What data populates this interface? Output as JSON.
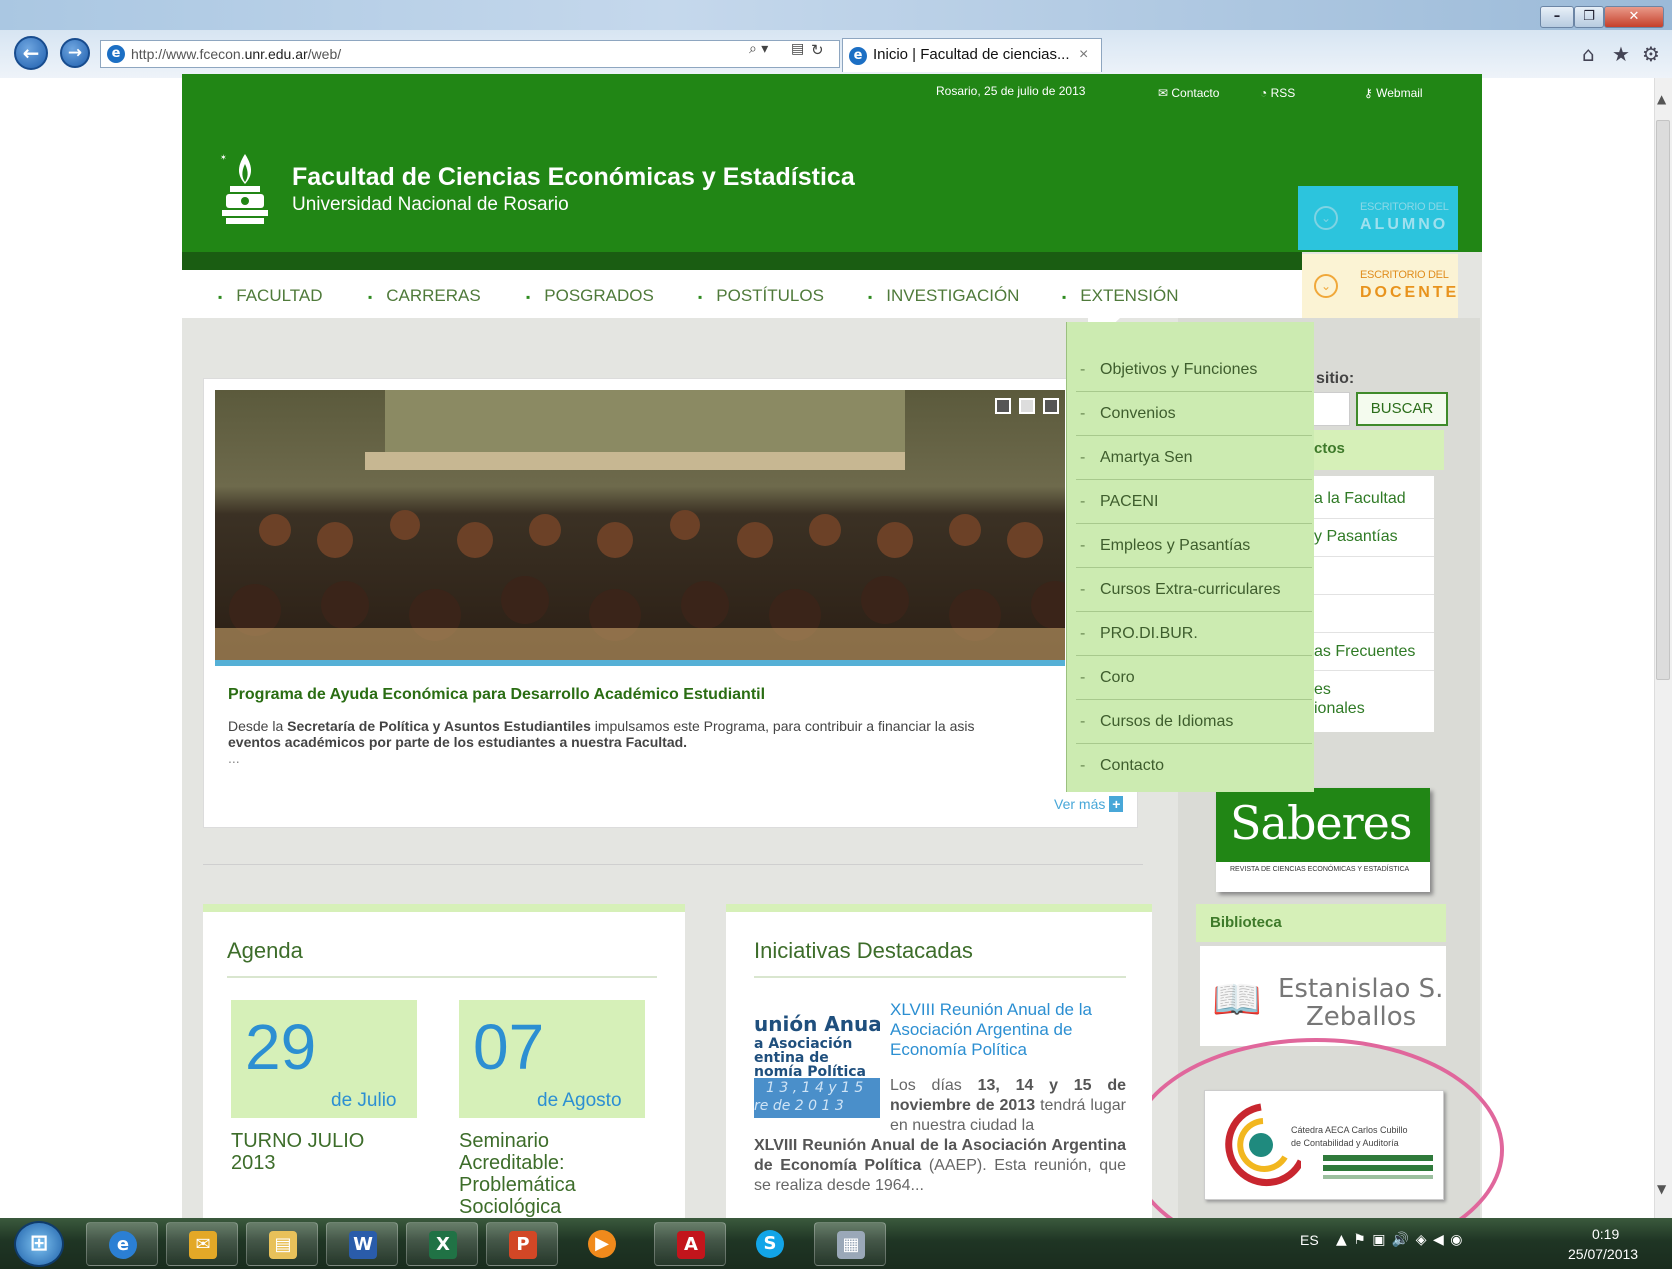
{
  "browser": {
    "url_prefix": "http://www.fcecon.",
    "url_domain": "unr.edu.ar",
    "url_suffix": "/web/",
    "tab_title": "Inicio | Facultad de ciencias...",
    "tab_close": "×",
    "back_glyph": "←",
    "forward_glyph": "→",
    "home_glyph": "⌂",
    "star_glyph": "★",
    "gear_glyph": "⚙",
    "search_glyph": "⌕ ▾",
    "compat_glyph": "▤",
    "refresh_glyph": "↻",
    "minimize": "–",
    "restore": "❐",
    "close": "✕"
  },
  "site": {
    "date": "Rosario, 25 de julio de 2013",
    "links": [
      "Contacto",
      "RSS",
      "Webmail"
    ],
    "title": "Facultad de Ciencias Económicas y Estadística",
    "subtitle": "Universidad Nacional de Rosario",
    "escritorio_small": "ESCRITORIO DEL",
    "escritorio_alumno": "ALUMNO",
    "escritorio_docente": "DOCENTE",
    "nav": [
      "FACULTAD",
      "CARRERAS",
      "POSGRADOS",
      "POSTÍTULOS",
      "INVESTIGACIÓN",
      "EXTENSIÓN"
    ]
  },
  "dropdown": [
    "Objetivos y Funciones",
    "Convenios",
    "Amartya Sen",
    "PACENI",
    "Empleos y Pasantías",
    "Cursos Extra-curriculares",
    "PRO.DI.BUR.",
    "Coro",
    "Cursos de Idiomas",
    "Contacto"
  ],
  "featured": {
    "title": "Programa de Ayuda Económica para Desarrollo Académico Estudiantil",
    "line1_a": "Desde la ",
    "line1_b": "Secretaría de Política y Asuntos Estudiantiles",
    "line1_c": " impulsamos este Programa, para contribuir a financiar la asis",
    "line2": "eventos académicos por parte de los estudiantes a nuestra Facultad.",
    "ellipsis": "...",
    "more": "Ver más"
  },
  "sidebar": {
    "search_label": "sitio:",
    "search_button": "BUSCAR",
    "header_frag": "ctos",
    "items": [
      "a la Facultad",
      "y Pasantías",
      "",
      "",
      "as Frecuentes",
      "es",
      "ionales"
    ],
    "saberes": "Saberes",
    "saberes_sub": "REVISTA DE CIENCIAS ECONÓMICAS Y ESTADÍSTICA",
    "biblioteca": "Biblioteca",
    "biblio_name1": "Estanislao S.",
    "biblio_name2": "Zeballos",
    "catedra1": "Cátedra AECA Carlos Cubillo",
    "catedra2": "de Contabilidad y Auditoría"
  },
  "agenda": {
    "title": "Agenda",
    "events": [
      {
        "day": "29",
        "month": "de Julio",
        "text": "TURNO JULIO 2013"
      },
      {
        "day": "07",
        "month": "de Agosto",
        "text": "Seminario Acreditable: Problemática Sociológica"
      }
    ]
  },
  "iniciativas": {
    "title": "Iniciativas Destacadas",
    "img_l1": "unión Anual",
    "img_l2": "a Asociación",
    "img_l3": "entina de",
    "img_l4": "nomía Política",
    "img_l5": "1 3 , 1 4 y 1 5",
    "img_l6": "re de 2 0 1 3",
    "headline": "XLVIII Reunión Anual de la Asociación Argentina de Economía Política",
    "p1": "Los días ",
    "p1b": "13, 14 y 15 de noviembre de 2013",
    "p1c": " tendrá lugar en nuestra ciudad la ",
    "p1d": "XLVIII Reunión Anual de la Asociación Argentina de Economía Política",
    "p1e": " (AAEP). Esta reunión, que se realiza desde 1964..."
  },
  "taskbar": {
    "lang": "ES",
    "time": "0:19",
    "date": "25/07/2013",
    "apps": [
      "windows-start",
      "internet-explorer",
      "outlook",
      "explorer",
      "word",
      "excel",
      "presentation",
      "media-player",
      "acrobat",
      "skype",
      "calculator"
    ],
    "app_glyphs": [
      "⊞",
      "e",
      "✉",
      "▤",
      "W",
      "X",
      "P",
      "▶",
      "A",
      "S",
      "▦"
    ],
    "tray_glyphs": "▲  ⚑  ▣  🔊  ◈  ◀  ◉"
  },
  "colors": {
    "header_green": "#218615",
    "annotation_ring": "#e0679c",
    "accent_blue": "#2c8fd2"
  }
}
